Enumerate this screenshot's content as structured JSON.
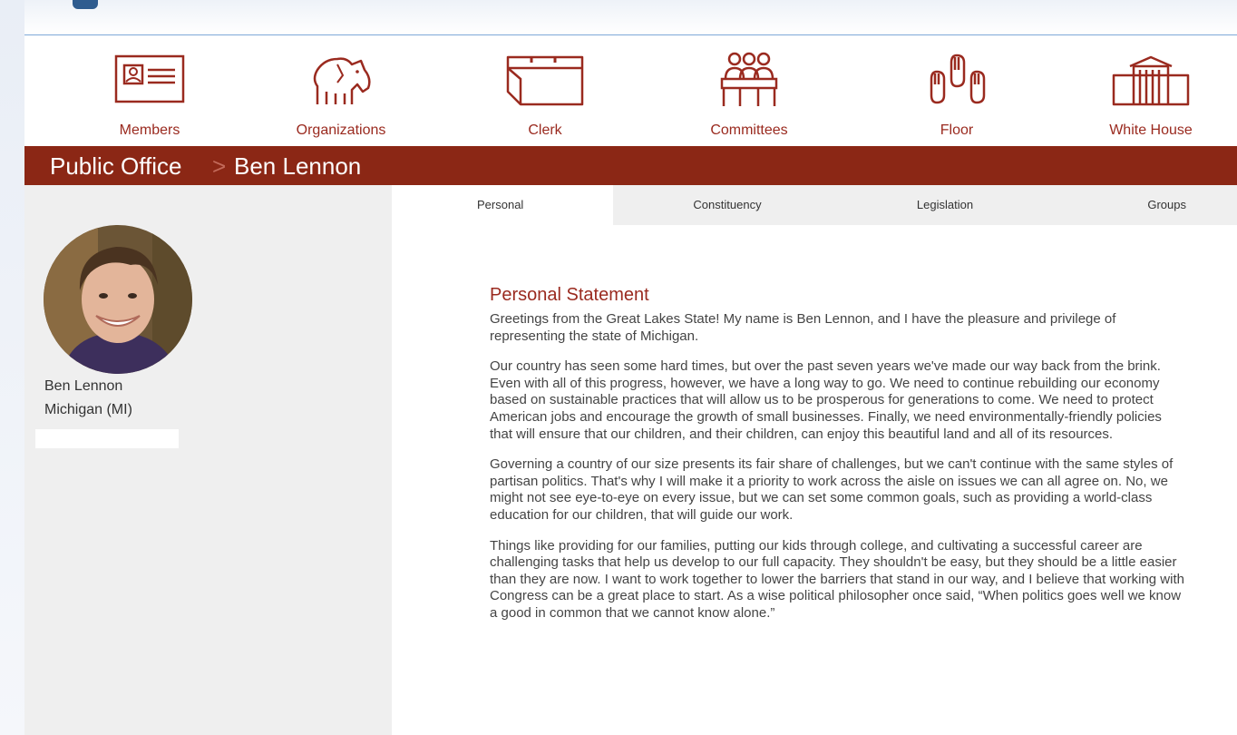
{
  "nav": {
    "items": [
      {
        "label": "Members",
        "icon": "id-card-icon"
      },
      {
        "label": "Organizations",
        "icon": "donkey-elephant-icon"
      },
      {
        "label": "Clerk",
        "icon": "inbox-tray-icon"
      },
      {
        "label": "Committees",
        "icon": "committee-people-icon"
      },
      {
        "label": "Floor",
        "icon": "raised-hands-icon"
      },
      {
        "label": "White House",
        "icon": "white-house-icon"
      }
    ],
    "accent": "#9a2a1f"
  },
  "breadcrumb": {
    "root": "Public Office",
    "separator": ">",
    "current": "Ben Lennon",
    "bar_color": "#8b2715"
  },
  "profile": {
    "name": "Ben Lennon",
    "state": "Michigan (MI)"
  },
  "tabs": [
    {
      "label": "Personal",
      "active": true
    },
    {
      "label": "Constituency",
      "active": false
    },
    {
      "label": "Legislation",
      "active": false
    },
    {
      "label": "Groups",
      "active": false
    }
  ],
  "statement": {
    "heading": "Personal Statement",
    "paragraphs": [
      "Greetings from the Great Lakes State! My name is Ben Lennon, and I have the pleasure and privilege of representing the state of Michigan.",
      "Our country has seen some hard times, but over the past seven years we've made our way back from the brink. Even with all of this progress, however, we have a long way to go. We need to continue rebuilding our economy based on sustainable practices that will allow us to be prosperous for generations to come. We need to protect American jobs and encourage the growth of small businesses. Finally, we need environmentally-friendly policies that will ensure that our children, and their children, can enjoy this beautiful land and all of its resources.",
      "Governing a country of our size presents its fair share of challenges, but we can't continue with the same styles of partisan politics. That's why I will make it a priority to work across the aisle on issues we can all agree on. No, we might not see eye-to-eye on every issue, but we can set some common goals, such as providing a world-class education for our children, that will guide our work.",
      "Things like providing for our families, putting our kids through college, and cultivating a successful career are challenging tasks that help us develop to our full capacity. They shouldn't be easy, but they should be a little easier than they are now. I want to work together to lower the barriers that stand in our way, and I believe that working with Congress can be a great place to start. As a wise political philosopher once said, “When politics goes well we know a good in common that we cannot know alone.”"
    ]
  }
}
